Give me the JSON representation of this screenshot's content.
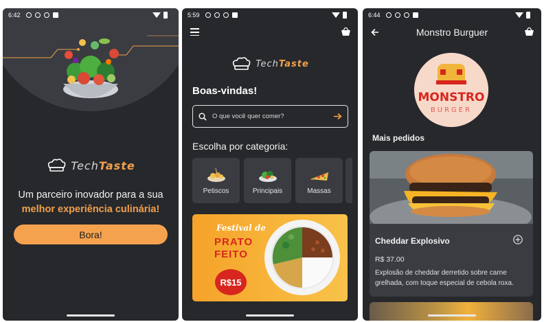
{
  "screens": [
    {
      "status_time": "6:42",
      "logo": {
        "part1": "Tech",
        "part2": "Taste"
      },
      "tagline": "Um parceiro inovador para a sua",
      "tagline_highlight": "melhor experiência culinária!",
      "cta_label": "Bora!"
    },
    {
      "status_time": "5:59",
      "logo": {
        "part1": "Tech",
        "part2": "Taste"
      },
      "welcome": "Boas-vindas!",
      "search": {
        "placeholder": "O que você quer comer?"
      },
      "category_title": "Escolha por categoria:",
      "categories": [
        {
          "label": "Petiscos",
          "icon": "petiscos-icon"
        },
        {
          "label": "Principais",
          "icon": "principais-icon"
        },
        {
          "label": "Massas",
          "icon": "massas-icon"
        }
      ],
      "banner": {
        "title_line1": "Festival de",
        "title_line2": "PRATO",
        "title_line3": "FEITO",
        "price": "R$15"
      }
    },
    {
      "status_time": "6:44",
      "store_title": "Monstro Burguer",
      "brand_logo_text": [
        "MONSTRO",
        "BURGER"
      ],
      "section_title": "Mais pedidos",
      "dish": {
        "name": "Cheddar Explosivo",
        "price": "R$ 37.00",
        "description": "Explosão de cheddar derretido sobre carne grelhada, com toque especial de cebola roxa."
      }
    }
  ],
  "colors": {
    "background": "#26282c",
    "surface": "#3a3c42",
    "accent": "#f5a24f",
    "text": "#f2f2f2"
  }
}
